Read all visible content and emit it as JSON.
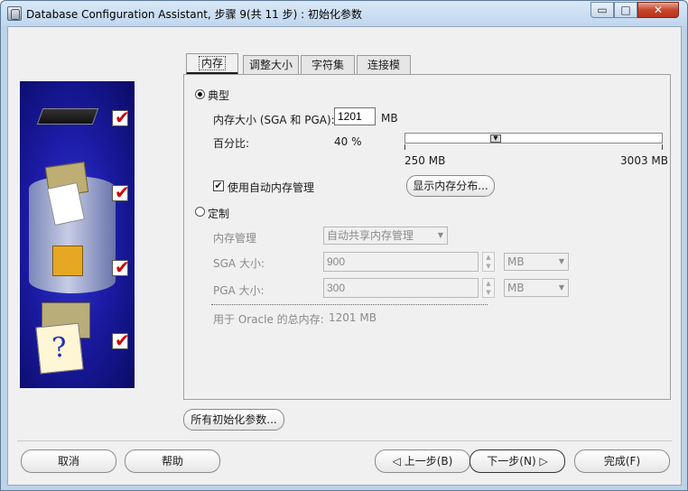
{
  "window": {
    "title": "Database Configuration Assistant, 步骤 9(共 11 步) : 初始化参数",
    "min_glyph": "▭",
    "max_glyph": "□",
    "close_glyph": "✕",
    "icon": "database-app-icon"
  },
  "tabs": [
    {
      "label": "内存",
      "active": true
    },
    {
      "label": "调整大小",
      "active": false
    },
    {
      "label": "字符集",
      "active": false
    },
    {
      "label": "连接模式",
      "active": false
    }
  ],
  "typical": {
    "radio_label": "典型",
    "selected": true,
    "memory_size_label": "内存大小 (SGA 和 PGA):",
    "memory_size_value": "1201",
    "memory_unit": "MB",
    "percentage_label": "百分比:",
    "percentage_value": "40 %",
    "slider_min_label": "250 MB",
    "slider_max_label": "3003 MB",
    "slider_fraction": 0.345,
    "auto_memory_label": "使用自动内存管理",
    "auto_memory_checked": true,
    "show_distribution_button": "显示内存分布..."
  },
  "custom": {
    "radio_label": "定制",
    "selected": false,
    "memory_mgmt_label": "内存管理",
    "memory_mgmt_value": "自动共享内存管理",
    "sga_label": "SGA 大小:",
    "sga_value": "900",
    "sga_unit": "MB",
    "pga_label": "PGA 大小:",
    "pga_value": "300",
    "pga_unit": "MB",
    "total_label": "用于 Oracle 的总内存:",
    "total_value": "1201 MB"
  },
  "all_params_button": "所有初始化参数...",
  "footer": {
    "cancel": "取消",
    "help": "帮助",
    "back": "上一步(B)",
    "next": "下一步(N)",
    "finish": "完成(F)",
    "back_glyph": "◁",
    "next_glyph": "▷"
  },
  "illustration": {
    "check_glyph": "✔",
    "question_glyph": "?"
  },
  "colors": {
    "title_bar": "#c0d6ee",
    "illustration_bg": "#1c1ca8",
    "checkmark": "#cc0000"
  }
}
